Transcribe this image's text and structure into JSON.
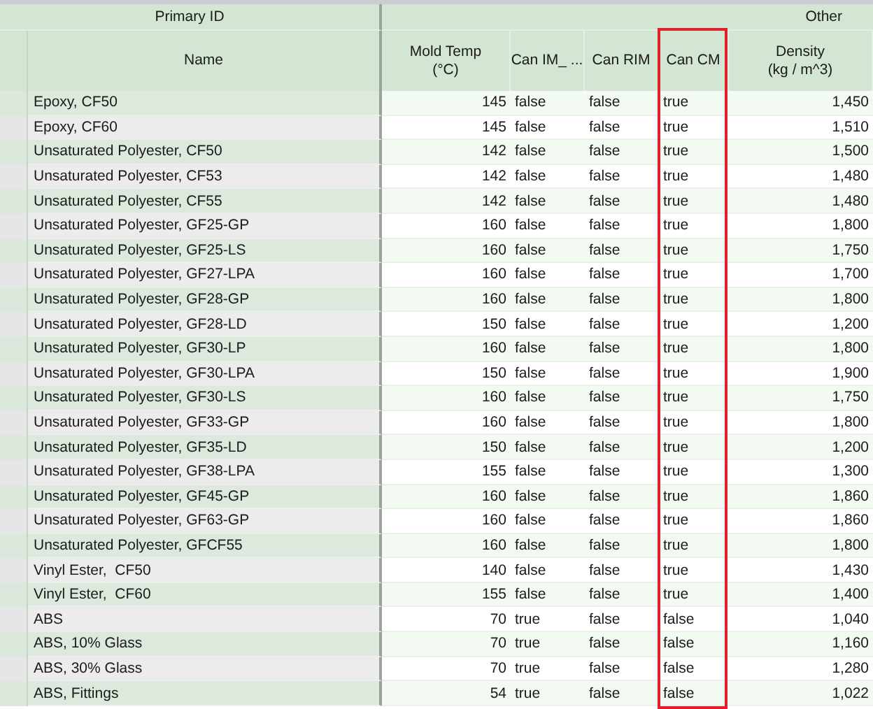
{
  "groups": [
    {
      "label": "Primary ID"
    },
    {
      "label": "Other"
    }
  ],
  "columns": [
    {
      "label": "Name",
      "highlighted": false
    },
    {
      "label": "Mold Temp\n(°C)",
      "highlighted": false
    },
    {
      "label": "Can IM_ ...",
      "highlighted": false
    },
    {
      "label": "Can RIM",
      "highlighted": false
    },
    {
      "label": "Can CM",
      "highlighted": true
    },
    {
      "label": "Density\n(kg / m^3)",
      "highlighted": false
    }
  ],
  "rows": [
    [
      "Epoxy, CF50",
      "145",
      "false",
      "false",
      "true",
      "1,450"
    ],
    [
      "Epoxy, CF60",
      "145",
      "false",
      "false",
      "true",
      "1,510"
    ],
    [
      "Unsaturated Polyester, CF50",
      "142",
      "false",
      "false",
      "true",
      "1,500"
    ],
    [
      "Unsaturated Polyester, CF53",
      "142",
      "false",
      "false",
      "true",
      "1,480"
    ],
    [
      "Unsaturated Polyester, CF55",
      "142",
      "false",
      "false",
      "true",
      "1,480"
    ],
    [
      "Unsaturated Polyester, GF25-GP",
      "160",
      "false",
      "false",
      "true",
      "1,800"
    ],
    [
      "Unsaturated Polyester, GF25-LS",
      "160",
      "false",
      "false",
      "true",
      "1,750"
    ],
    [
      "Unsaturated Polyester, GF27-LPA",
      "160",
      "false",
      "false",
      "true",
      "1,700"
    ],
    [
      "Unsaturated Polyester, GF28-GP",
      "160",
      "false",
      "false",
      "true",
      "1,800"
    ],
    [
      "Unsaturated Polyester, GF28-LD",
      "150",
      "false",
      "false",
      "true",
      "1,200"
    ],
    [
      "Unsaturated Polyester, GF30-LP",
      "160",
      "false",
      "false",
      "true",
      "1,800"
    ],
    [
      "Unsaturated Polyester, GF30-LPA",
      "150",
      "false",
      "false",
      "true",
      "1,900"
    ],
    [
      "Unsaturated Polyester, GF30-LS",
      "160",
      "false",
      "false",
      "true",
      "1,750"
    ],
    [
      "Unsaturated Polyester, GF33-GP",
      "160",
      "false",
      "false",
      "true",
      "1,800"
    ],
    [
      "Unsaturated Polyester, GF35-LD",
      "150",
      "false",
      "false",
      "true",
      "1,200"
    ],
    [
      "Unsaturated Polyester, GF38-LPA",
      "155",
      "false",
      "false",
      "true",
      "1,300"
    ],
    [
      "Unsaturated Polyester, GF45-GP",
      "160",
      "false",
      "false",
      "true",
      "1,860"
    ],
    [
      "Unsaturated Polyester, GF63-GP",
      "160",
      "false",
      "false",
      "true",
      "1,860"
    ],
    [
      "Unsaturated Polyester, GFCF55",
      "160",
      "false",
      "false",
      "true",
      "1,800"
    ],
    [
      "Vinyl Ester,  CF50",
      "140",
      "false",
      "false",
      "true",
      "1,430"
    ],
    [
      "Vinyl Ester,  CF60",
      "155",
      "false",
      "false",
      "true",
      "1,400"
    ],
    [
      "ABS",
      "70",
      "true",
      "false",
      "false",
      "1,040"
    ],
    [
      "ABS, 10% Glass",
      "70",
      "true",
      "false",
      "false",
      "1,160"
    ],
    [
      "ABS, 30% Glass",
      "70",
      "true",
      "false",
      "false",
      "1,280"
    ],
    [
      "ABS, Fittings",
      "54",
      "true",
      "false",
      "false",
      "1,022"
    ]
  ]
}
